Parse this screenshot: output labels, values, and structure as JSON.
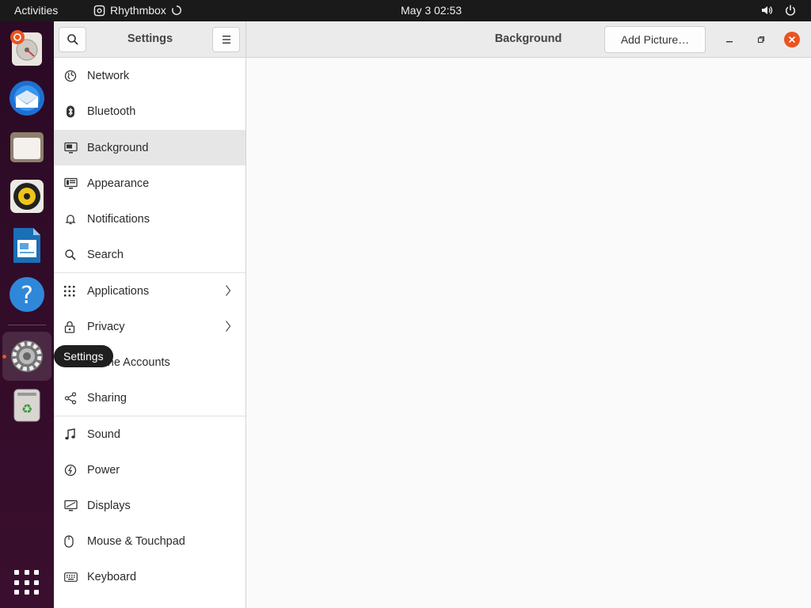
{
  "topbar": {
    "activities": "Activities",
    "app_name": "Rhythmbox",
    "clock": "May 3  02:53"
  },
  "dock": {
    "tooltip": "Settings",
    "items": [
      "files-app",
      "thunderbird",
      "file-manager",
      "rhythmbox",
      "writer",
      "help",
      "settings",
      "trash"
    ]
  },
  "window": {
    "sidebar_title": "Settings",
    "page_title": "Background",
    "add_picture_label": "Add Picture…"
  },
  "sidebar": {
    "items": [
      {
        "label": "Network",
        "icon": "network-icon"
      },
      {
        "label": "Bluetooth",
        "icon": "bluetooth-icon"
      },
      {
        "label": "Background",
        "icon": "background-icon",
        "selected": true
      },
      {
        "label": "Appearance",
        "icon": "appearance-icon"
      },
      {
        "label": "Notifications",
        "icon": "bell-icon"
      },
      {
        "label": "Search",
        "icon": "search-icon"
      },
      {
        "label": "Applications",
        "icon": "apps-icon",
        "chevron": true
      },
      {
        "label": "Privacy",
        "icon": "lock-icon",
        "chevron": true
      },
      {
        "label": "Online Accounts",
        "icon": "cloud-icon"
      },
      {
        "label": "Sharing",
        "icon": "share-icon"
      },
      {
        "label": "Sound",
        "icon": "music-icon"
      },
      {
        "label": "Power",
        "icon": "power-icon"
      },
      {
        "label": "Displays",
        "icon": "display-icon"
      },
      {
        "label": "Mouse & Touchpad",
        "icon": "mouse-icon"
      },
      {
        "label": "Keyboard",
        "icon": "keyboard-icon"
      }
    ]
  },
  "colors": {
    "accent": "#e95420",
    "selected_row": "#e6e6e6",
    "close_button": "#e95420"
  }
}
